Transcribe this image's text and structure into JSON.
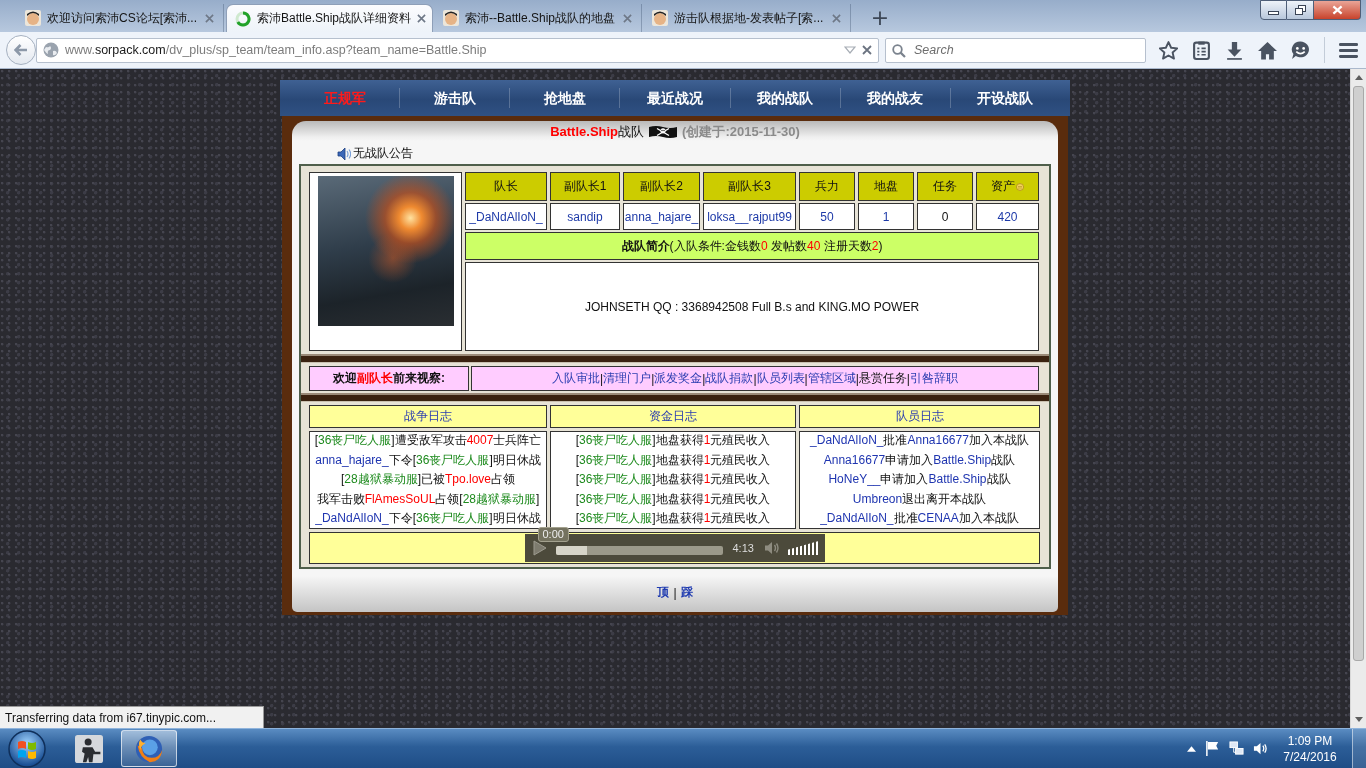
{
  "browser": {
    "tabs": [
      {
        "title": "欢迎访问索沛CS论坛[索沛...",
        "selected": false,
        "loading": false
      },
      {
        "title": "索沛Battle.Ship战队详细资料",
        "selected": true,
        "loading": true
      },
      {
        "title": "索沛--Battle.Ship战队的地盘",
        "selected": false,
        "loading": false
      },
      {
        "title": "游击队根据地-发表帖子[索...",
        "selected": false,
        "loading": false
      }
    ],
    "new_tab": "+",
    "address": {
      "prefix": "www.",
      "host": "sorpack.com",
      "path": "/dv_plus/sp_team/team_info.asp?team_name=Battle.Ship"
    },
    "search": {
      "placeholder": "Search"
    }
  },
  "nav": [
    {
      "label": "正规军",
      "selected": true
    },
    {
      "label": "游击队",
      "selected": false
    },
    {
      "label": "抢地盘",
      "selected": false
    },
    {
      "label": "最近战况",
      "selected": false
    },
    {
      "label": "我的战队",
      "selected": false
    },
    {
      "label": "我的战友",
      "selected": false
    },
    {
      "label": "开设战队",
      "selected": false
    }
  ],
  "team": {
    "name": "Battle.Ship",
    "suffix": "战队",
    "created": "(创建于:2015-11-30)",
    "announcement": "无战队公告"
  },
  "roster": {
    "columns": [
      {
        "label": "队长",
        "icon": false
      },
      {
        "label": "副队长1",
        "icon": false
      },
      {
        "label": "副队长2",
        "icon": false
      },
      {
        "label": "副队长3",
        "icon": false
      },
      {
        "label": "兵力",
        "icon": false
      },
      {
        "label": "地盘",
        "icon": false
      },
      {
        "label": "任务",
        "icon": false
      },
      {
        "label": "资产",
        "icon": true
      }
    ],
    "values": [
      {
        "text": "_DaNdAlIoN_",
        "link": true
      },
      {
        "text": "sandip",
        "link": true
      },
      {
        "text": "anna_hajare_",
        "link": true
      },
      {
        "text": "loksa__rajput99",
        "link": true
      },
      {
        "text": "50",
        "link": true
      },
      {
        "text": "1",
        "link": true
      },
      {
        "text": "0",
        "link": false
      },
      {
        "text": "420",
        "link": true
      }
    ],
    "intro": [
      {
        "text": "战队简介",
        "kind": "bold"
      },
      {
        "text": "(入队条件:金钱数",
        "kind": "text"
      },
      {
        "text": "0",
        "kind": "alert"
      },
      {
        "text": " 发帖数",
        "kind": "text"
      },
      {
        "text": "40",
        "kind": "alert"
      },
      {
        "text": " 注册天数",
        "kind": "text"
      },
      {
        "text": "2",
        "kind": "alert"
      },
      {
        "text": ")",
        "kind": "text"
      }
    ],
    "description": "JOHNSETH QQ : 3368942508 Full B.s and KING.MO POWER"
  },
  "admin": {
    "welcome": [
      {
        "text": "欢迎",
        "kind": "text"
      },
      {
        "text": "副队长",
        "kind": "alert"
      },
      {
        "text": "前来视察:",
        "kind": "text"
      }
    ],
    "separator": "|",
    "actions": [
      {
        "label": "入队审批",
        "disabled": false
      },
      {
        "label": "清理门户",
        "disabled": false
      },
      {
        "label": "派发奖金",
        "disabled": false
      },
      {
        "label": "战队捐款",
        "disabled": false
      },
      {
        "label": "队员列表",
        "disabled": false
      },
      {
        "label": "管辖区域",
        "disabled": false
      },
      {
        "label": "悬赏任务",
        "disabled": true
      },
      {
        "label": "引咎辞职",
        "disabled": false
      }
    ]
  },
  "logs": [
    {
      "title": "战争日志",
      "entries": [
        {
          "parts": [
            {
              "text": "[",
              "kind": "text"
            },
            {
              "text": "36丧尸吃人服",
              "kind": "place"
            },
            {
              "text": "]遭受敌军攻击",
              "kind": "text"
            },
            {
              "text": "4007",
              "kind": "alert"
            },
            {
              "text": "士兵阵亡",
              "kind": "text"
            }
          ]
        },
        {
          "parts": [
            {
              "text": "anna_hajare_",
              "kind": "player"
            },
            {
              "text": "下令[",
              "kind": "text"
            },
            {
              "text": "36丧尸吃人服",
              "kind": "place"
            },
            {
              "text": "]明日休战",
              "kind": "text"
            }
          ]
        },
        {
          "parts": [
            {
              "text": "[",
              "kind": "text"
            },
            {
              "text": "28越狱暴动服",
              "kind": "place"
            },
            {
              "text": "]已被",
              "kind": "text"
            },
            {
              "text": "Tpo.love",
              "kind": "alert"
            },
            {
              "text": "占领",
              "kind": "text"
            }
          ]
        },
        {
          "parts": [
            {
              "text": "我军击败",
              "kind": "text"
            },
            {
              "text": "FlAmesSoUL",
              "kind": "alert"
            },
            {
              "text": "占领[",
              "kind": "text"
            },
            {
              "text": "28越狱暴动服",
              "kind": "place"
            },
            {
              "text": "]",
              "kind": "text"
            }
          ]
        },
        {
          "parts": [
            {
              "text": "_DaNdAlIoN_",
              "kind": "player"
            },
            {
              "text": "下令[",
              "kind": "text"
            },
            {
              "text": "36丧尸吃人服",
              "kind": "place"
            },
            {
              "text": "]明日休战",
              "kind": "text"
            }
          ]
        }
      ]
    },
    {
      "title": "资金日志",
      "entries": [
        {
          "parts": [
            {
              "text": "[",
              "kind": "text"
            },
            {
              "text": "36丧尸吃人服",
              "kind": "place"
            },
            {
              "text": "]地盘获得",
              "kind": "text"
            },
            {
              "text": "1",
              "kind": "alert"
            },
            {
              "text": "元殖民收入",
              "kind": "text"
            }
          ]
        },
        {
          "parts": [
            {
              "text": "[",
              "kind": "text"
            },
            {
              "text": "36丧尸吃人服",
              "kind": "place"
            },
            {
              "text": "]地盘获得",
              "kind": "text"
            },
            {
              "text": "1",
              "kind": "alert"
            },
            {
              "text": "元殖民收入",
              "kind": "text"
            }
          ]
        },
        {
          "parts": [
            {
              "text": "[",
              "kind": "text"
            },
            {
              "text": "36丧尸吃人服",
              "kind": "place"
            },
            {
              "text": "]地盘获得",
              "kind": "text"
            },
            {
              "text": "1",
              "kind": "alert"
            },
            {
              "text": "元殖民收入",
              "kind": "text"
            }
          ]
        },
        {
          "parts": [
            {
              "text": "[",
              "kind": "text"
            },
            {
              "text": "36丧尸吃人服",
              "kind": "place"
            },
            {
              "text": "]地盘获得",
              "kind": "text"
            },
            {
              "text": "1",
              "kind": "alert"
            },
            {
              "text": "元殖民收入",
              "kind": "text"
            }
          ]
        },
        {
          "parts": [
            {
              "text": "[",
              "kind": "text"
            },
            {
              "text": "36丧尸吃人服",
              "kind": "place"
            },
            {
              "text": "]地盘获得",
              "kind": "text"
            },
            {
              "text": "1",
              "kind": "alert"
            },
            {
              "text": "元殖民收入",
              "kind": "text"
            }
          ]
        }
      ]
    },
    {
      "title": "队员日志",
      "entries": [
        {
          "parts": [
            {
              "text": "_DaNdAlIoN_",
              "kind": "player"
            },
            {
              "text": "批准",
              "kind": "text"
            },
            {
              "text": "Anna16677",
              "kind": "player"
            },
            {
              "text": "加入本战队",
              "kind": "text"
            }
          ]
        },
        {
          "parts": [
            {
              "text": "Anna16677",
              "kind": "player"
            },
            {
              "text": "申请加入",
              "kind": "text"
            },
            {
              "text": "Battle.Ship",
              "kind": "player"
            },
            {
              "text": "战队",
              "kind": "text"
            }
          ]
        },
        {
          "parts": [
            {
              "text": "HoNeY__",
              "kind": "player"
            },
            {
              "text": "申请加入",
              "kind": "text"
            },
            {
              "text": "Battle.Ship",
              "kind": "player"
            },
            {
              "text": "战队",
              "kind": "text"
            }
          ]
        },
        {
          "parts": [
            {
              "text": "Umbreon",
              "kind": "player"
            },
            {
              "text": "退出离开本战队",
              "kind": "text"
            }
          ]
        },
        {
          "parts": [
            {
              "text": "_DaNdAlIoN_",
              "kind": "player"
            },
            {
              "text": "批准",
              "kind": "text"
            },
            {
              "text": "CENAA",
              "kind": "player"
            },
            {
              "text": "加入本战队",
              "kind": "text"
            }
          ]
        }
      ]
    }
  ],
  "player": {
    "current_time": "0:00",
    "duration": "4:13",
    "progress": {
      "level": 0.19
    },
    "volume": {
      "level": 1
    }
  },
  "footer": {
    "links": [
      "顶",
      "踩"
    ],
    "separator": "|"
  },
  "status": "Transferring data from i67.tinypic.com...",
  "taskbar": {
    "apps": [
      {
        "kind": "game",
        "selected": false
      },
      {
        "kind": "browser",
        "selected": true
      }
    ],
    "clock": {
      "time": "1:09 PM",
      "date": "7/24/2016"
    }
  }
}
